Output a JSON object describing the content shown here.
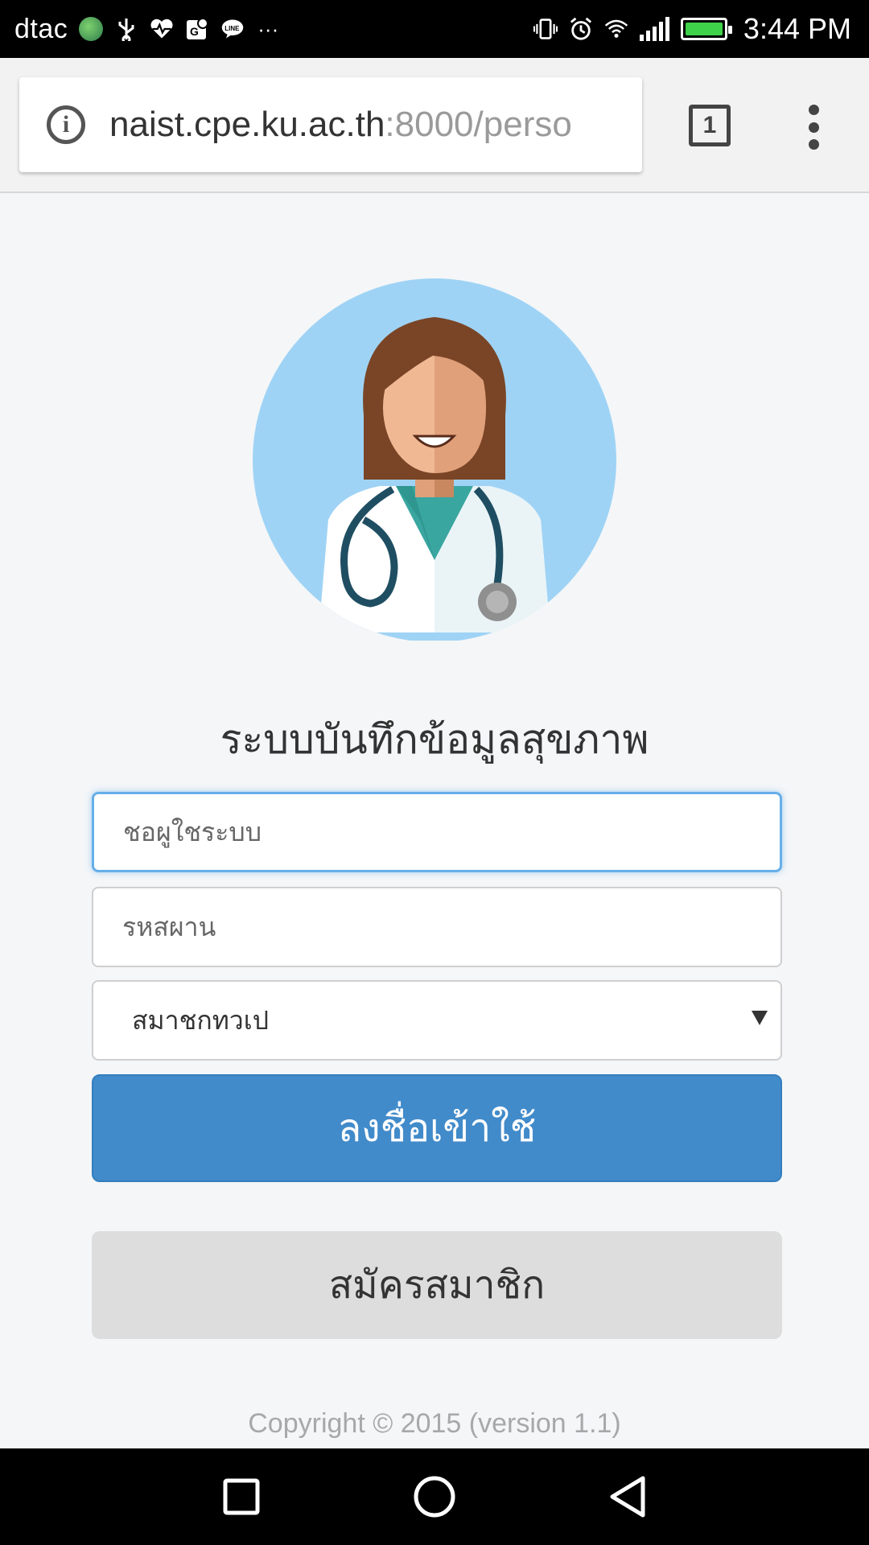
{
  "status_bar": {
    "carrier": "dtac",
    "time": "3:44 PM",
    "more_glyph": "···",
    "icons": [
      "globe-icon",
      "usb-icon",
      "health-icon",
      "maps-icon",
      "line-icon",
      "vibrate-icon",
      "alarm-icon",
      "wifi-icon",
      "signal-icon",
      "battery-icon"
    ],
    "battery_fill_color": "#3ed14a"
  },
  "browser": {
    "url_host": "naist.cpe.ku.ac.th",
    "url_rest": ":8000/perso",
    "tab_count": "1",
    "info_glyph": "i"
  },
  "page": {
    "title": "ระบบบันทึกข้อมูลสุขภาพ",
    "username_placeholder": "ชอผูใชระบบ",
    "password_placeholder": "รหสผาน",
    "role_select_value": "สมาชกทวเป",
    "login_label": "ลงชื่อเข้าใช้",
    "register_label": "สมัครสมาชิก",
    "copyright": "Copyright © 2015 (version 1.1)"
  },
  "colors": {
    "primary_button": "#428bca",
    "secondary_button": "#dddddd",
    "focus_border": "#66afe9",
    "avatar_bg": "#9fd3f5"
  },
  "nav": {
    "buttons": [
      "recent-apps",
      "home",
      "back"
    ]
  }
}
